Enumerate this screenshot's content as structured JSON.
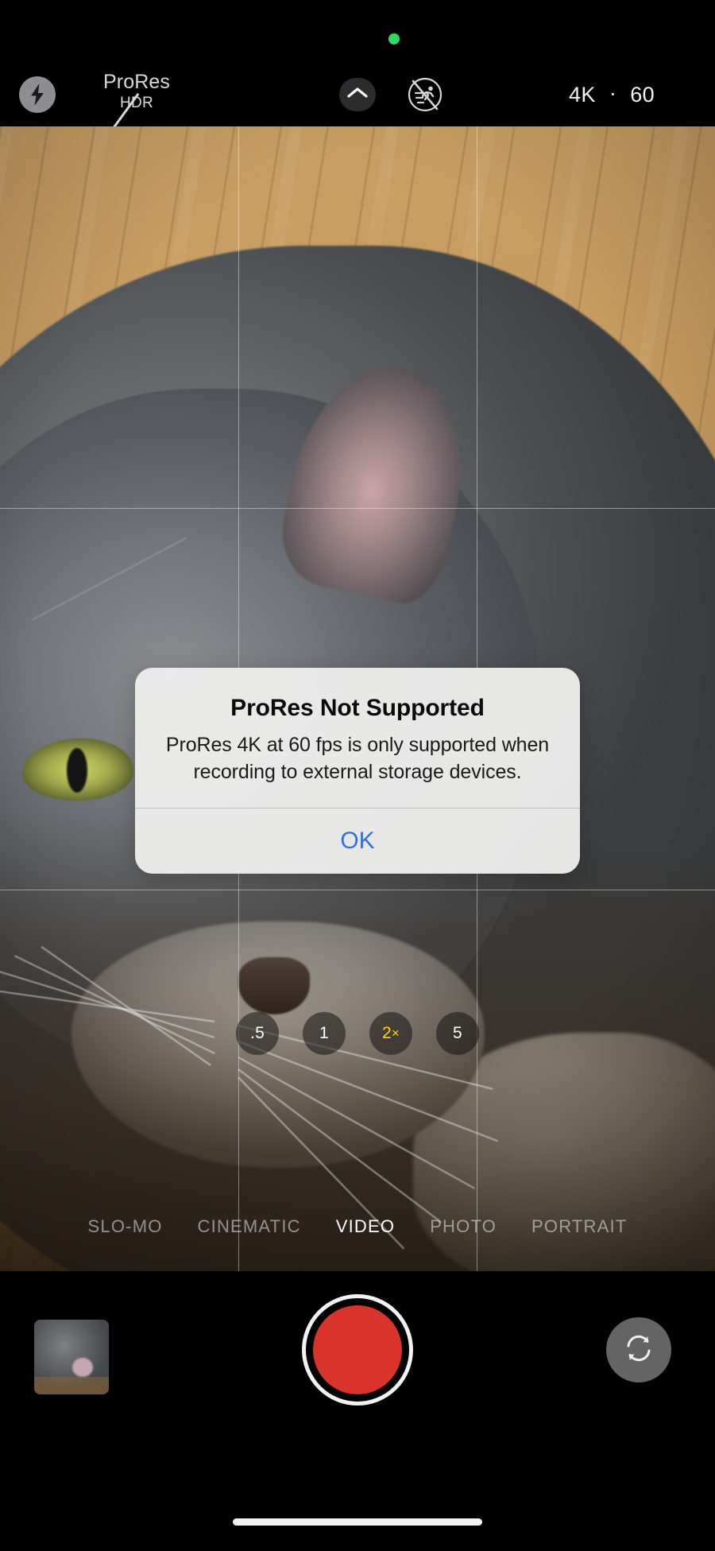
{
  "app": {
    "name": "Camera",
    "platform": "iOS"
  },
  "status_bar": {
    "recording_indicator": "green-recording-dot"
  },
  "top_bar": {
    "flash": {
      "icon": "flash-icon",
      "state": "on"
    },
    "prores": {
      "main_label": "ProRes",
      "sub_label": "HDR",
      "state": "disabled-strikethrough"
    },
    "chevron": {
      "icon": "chevron-up-icon",
      "label": ""
    },
    "action_mode": {
      "icon": "action-mode-off-icon",
      "state": "off"
    },
    "resolution": "4K",
    "separator": "·",
    "fps": "60"
  },
  "viewfinder": {
    "grid_enabled": true,
    "subject": "grey tabby cat on wooden floor"
  },
  "zoom_levels": [
    {
      "label": ".5",
      "suffix": "",
      "active": false
    },
    {
      "label": "1",
      "suffix": "",
      "active": false
    },
    {
      "label": "2",
      "suffix": "×",
      "active": true
    },
    {
      "label": "5",
      "suffix": "",
      "active": false
    }
  ],
  "modes": [
    {
      "label": "SLO-MO",
      "active": false
    },
    {
      "label": "CINEMATIC",
      "active": false
    },
    {
      "label": "VIDEO",
      "active": true
    },
    {
      "label": "PHOTO",
      "active": false
    },
    {
      "label": "PORTRAIT",
      "active": false
    }
  ],
  "bottom_bar": {
    "thumbnail_label": "last-photo-thumbnail",
    "record_button_label": "record-button",
    "flip_camera_label": "flip-camera-icon"
  },
  "home_indicator": "home-indicator",
  "alert": {
    "title": "ProRes Not Supported",
    "message": "ProRes 4K at 60 fps is only supported when recording to external storage devices.",
    "primary_action": "OK"
  },
  "colors": {
    "accent_blue": "#2f6fde",
    "record_red": "#d9342b",
    "recording_dot_green": "#2fd865",
    "zoom_active_yellow": "#ffd60a",
    "alert_bg": "#ededec"
  }
}
